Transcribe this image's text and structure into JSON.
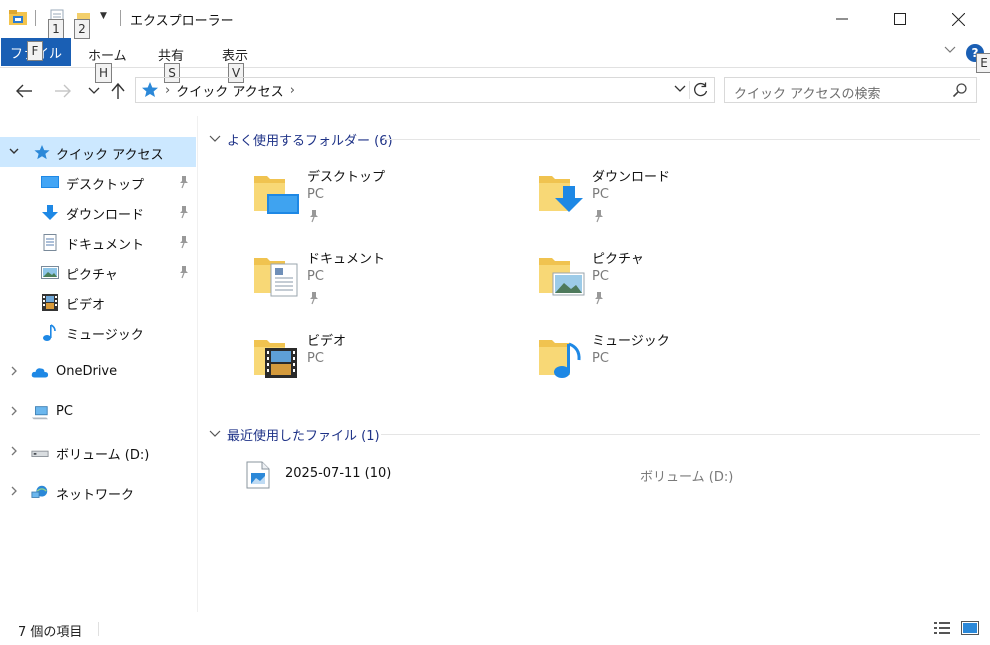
{
  "window": {
    "title": "エクスプローラー",
    "keytips": {
      "qa1": "1",
      "qa2": "2",
      "file": "F",
      "home": "H",
      "share": "S",
      "view": "V",
      "help": "E"
    },
    "help_label": "?"
  },
  "ribbon": {
    "tabs": {
      "file": "ファイル",
      "home": "ホーム",
      "share": "共有",
      "view": "表示"
    }
  },
  "address": {
    "crumbs": [
      "クイック アクセス"
    ],
    "search_placeholder": "クイック アクセスの検索"
  },
  "sidebar": {
    "quick_access": "クイック アクセス",
    "pinned": [
      {
        "label": "デスクトップ",
        "icon": "desktop-icon",
        "pinned": true
      },
      {
        "label": "ダウンロード",
        "icon": "download-icon",
        "pinned": true
      },
      {
        "label": "ドキュメント",
        "icon": "document-icon",
        "pinned": true
      },
      {
        "label": "ピクチャ",
        "icon": "picture-icon",
        "pinned": true
      },
      {
        "label": "ビデオ",
        "icon": "video-icon",
        "pinned": false
      },
      {
        "label": "ミュージック",
        "icon": "music-icon",
        "pinned": false
      }
    ],
    "roots": [
      {
        "label": "OneDrive",
        "icon": "onedrive-icon"
      },
      {
        "label": "PC",
        "icon": "pc-icon"
      },
      {
        "label": "ボリューム (D:)",
        "icon": "drive-icon"
      },
      {
        "label": "ネットワーク",
        "icon": "network-icon"
      }
    ]
  },
  "content": {
    "frequent_header": "よく使用するフォルダー (6)",
    "recent_header": "最近使用したファイル (1)",
    "folders": [
      {
        "name": "デスクトップ",
        "sub": "PC",
        "pinned": true,
        "overlay": "desktop"
      },
      {
        "name": "ダウンロード",
        "sub": "PC",
        "pinned": true,
        "overlay": "download"
      },
      {
        "name": "ドキュメント",
        "sub": "PC",
        "pinned": true,
        "overlay": "document"
      },
      {
        "name": "ピクチャ",
        "sub": "PC",
        "pinned": true,
        "overlay": "picture"
      },
      {
        "name": "ビデオ",
        "sub": "PC",
        "pinned": false,
        "overlay": "video"
      },
      {
        "name": "ミュージック",
        "sub": "PC",
        "pinned": false,
        "overlay": "music"
      }
    ],
    "recent_files": [
      {
        "name": "2025-07-11 (10)",
        "location": "ボリューム (D:)",
        "icon": "image-file-icon"
      }
    ]
  },
  "status": {
    "item_count": "7 個の項目"
  },
  "colors": {
    "accent": "#1a5fb4",
    "selection": "#cce8ff",
    "group_header": "#1e3287",
    "folder": "#f3cf6b"
  }
}
